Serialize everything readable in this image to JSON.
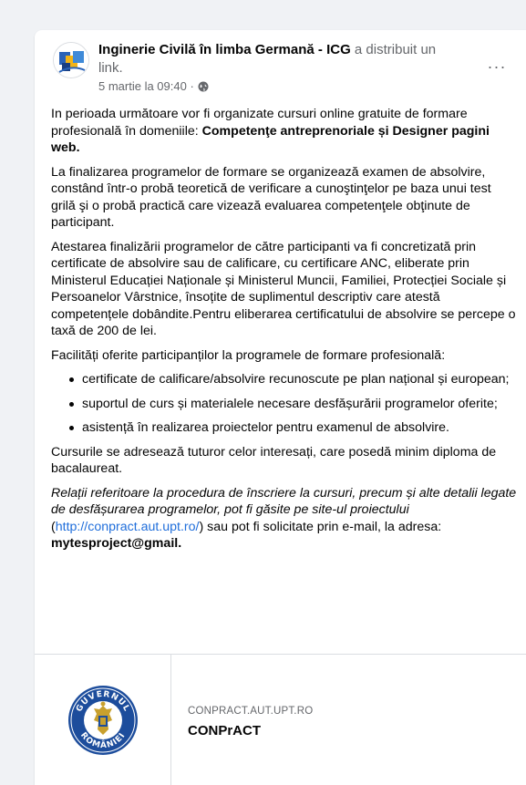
{
  "post": {
    "author": "Inginerie Civilă în limba Germană - ICG",
    "action": " a distribuit un link.",
    "timestamp": "5 martie la 09:40 · ",
    "more_label": "···",
    "paragraphs": {
      "p1_text": "In perioada următoare vor fi organizate cursuri online gratuite de formare profesională în domeniile: ",
      "p1_bold": "Competenţe antreprenoriale și Designer pagini web.",
      "p2": "La finalizarea programelor de formare se organizează examen de absolvire, constând într-o probă teoretică de verificare a cunoştinţelor pe baza unui test grilă şi o probă practică care vizează evaluarea competenţele obţinute de participant.",
      "p3": "Atestarea finalizării programelor de către participanti va fi concretizată prin certificate de absolvire sau de calificare, cu certificare ANC, eliberate prin Ministerul Educației Naționale și Ministerul Muncii, Familiei, Protecției Sociale și Persoanelor Vârstnice, însoțite de suplimentul descriptiv care atestă competențele dobândite.Pentru eliberarea certificatului de absolvire se percepe o taxă de 200 de lei.",
      "p4": "Facilități oferite participanților la programele de formare profesională:",
      "bullets": [
        "certificate de calificare/absolvire recunoscute pe plan național și european;",
        "suportul de curs și materialele necesare desfășurării programelor oferite;",
        "asistență în realizarea proiectelor pentru examenul de absolvire."
      ],
      "p5": "Cursurile se adresează tuturor celor interesați, care posedă minim diploma de bacalaureat.",
      "p6_italic": "Relații referitoare la procedura de înscriere la cursuri, precum și alte detalii legate de desfășurarea programelor, pot fi găsite pe site-ul proiectului",
      "p6_open": " (",
      "p6_link": "http://conpract.aut.upt.ro/",
      "p6_after": ") sau pot fi solicitate prin e-mail, la adresa: ",
      "p6_email": "mytesproject@gmail."
    }
  },
  "link_preview": {
    "domain": "CONPRACT.AUT.UPT.RO",
    "title": "CONPrACT",
    "logo_text_top": "GUVERNUL",
    "logo_text_bottom": "ROMÂNIEI"
  },
  "colors": {
    "background": "#f0f2f5",
    "card": "#ffffff",
    "secondary_text": "#65676b",
    "link": "#216fdb",
    "logo_blue": "#1d4d9c"
  },
  "icons": {
    "avatar": "icg-logo",
    "globe": "globe-icon",
    "more": "more-icon"
  }
}
